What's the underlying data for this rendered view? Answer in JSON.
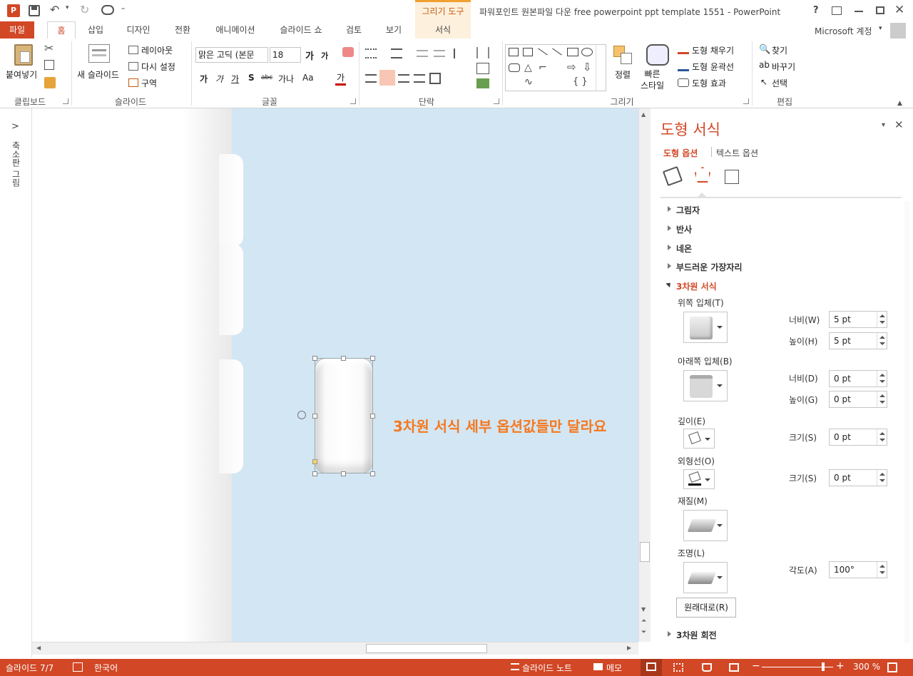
{
  "title_bar": {
    "app_icon": "P",
    "window_title": "파워포인트 원본파일 다운 free powerpoint ppt template 1551 - PowerPoint",
    "context_tool_group": "그리기 도구",
    "help": "?",
    "icons": [
      "save-icon",
      "undo-icon",
      "redo-icon",
      "presentation-icon",
      "customize-icon"
    ]
  },
  "tabs": [
    "파일",
    "홈",
    "삽입",
    "디자인",
    "전환",
    "애니메이션",
    "슬라이드 쇼",
    "검토",
    "보기",
    "서식"
  ],
  "account": "Microsoft 계정",
  "ribbon": {
    "clipboard": {
      "paste": "붙여넣기",
      "group": "클립보드"
    },
    "slides": {
      "new_slide": "새 슬라이드",
      "layout": "레이아웃",
      "reset": "다시 설정",
      "section": "구역",
      "group": "슬라이드"
    },
    "font": {
      "font_name": "맑은 고딕 (본문",
      "font_size": "18",
      "group": "글꼴",
      "bold": "가",
      "italic": "가",
      "underline": "가",
      "shadow": "S",
      "strike": "abc",
      "spacing": "가나",
      "case": "Aa",
      "color": "가"
    },
    "paragraph": {
      "group": "단락"
    },
    "drawing": {
      "arrange": "정렬",
      "quick_styles": "빠른\n스타일",
      "shape_fill": "도형 채우기",
      "shape_outline": "도형 윤곽선",
      "shape_effects": "도형 효과",
      "group": "그리기"
    },
    "editing": {
      "find": "찾기",
      "replace": "바꾸기",
      "select": "선택",
      "group": "편집"
    }
  },
  "left_strip": {
    "label": "축소판 그림",
    "expand": ">"
  },
  "slide": {
    "annotation": "3차원 서식 세부 옵션값들만 달라요"
  },
  "format_pane": {
    "title": "도형 서식",
    "tab_shape": "도형 옵션",
    "tab_text": "텍스트 옵션",
    "sections": [
      "그림자",
      "반사",
      "네온",
      "부드러운 가장자리"
    ],
    "section_3d": "3차원 서식",
    "section_rotation": "3차원 회전",
    "top_bevel": "위쪽 입체(T)",
    "bottom_bevel": "아래쪽 입체(B)",
    "depth": "깊이(E)",
    "contour": "외형선(O)",
    "material": "재질(M)",
    "lighting": "조명(L)",
    "reset": "원래대로(R)",
    "width_label": "너비(W)",
    "height_label": "높이(H)",
    "width2_label": "너비(D)",
    "height2_label": "높이(G)",
    "size_label": "크기(S)",
    "size2_label": "크기(S)",
    "angle_label": "각도(A)",
    "top_width": "5 pt",
    "top_height": "5 pt",
    "bottom_width": "0 pt",
    "bottom_height": "0 pt",
    "depth_size": "0 pt",
    "contour_size": "0 pt",
    "angle": "100°"
  },
  "status": {
    "slide": "슬라이드 7/7",
    "language": "한국어",
    "notes": "슬라이드 노트",
    "comments": "메모",
    "zoom": "300 %"
  },
  "colors": {
    "accent": "#d24726",
    "tab_context": "#fdf0dd",
    "slide_bg": "#d3e6f4",
    "annotation": "#f47920"
  }
}
